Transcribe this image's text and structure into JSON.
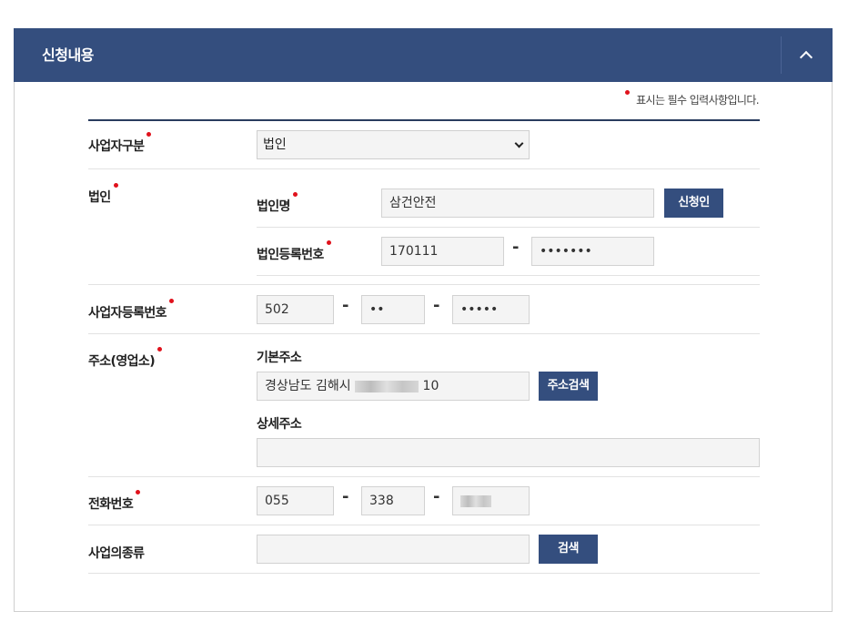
{
  "panel": {
    "title": "신청내용",
    "required_note": "표시는 필수 입력사항입니다."
  },
  "form": {
    "business_type": {
      "label": "사업자구분",
      "selected": "법인"
    },
    "corporation": {
      "label": "법인",
      "name": {
        "label": "법인명",
        "value": "삼건안전",
        "button": "신청인"
      },
      "reg_no": {
        "label": "법인등록번호",
        "part1": "170111",
        "part2": "•••••••"
      }
    },
    "business_reg_no": {
      "label": "사업자등록번호",
      "part1": "502",
      "part2": "••",
      "part3": "•••••"
    },
    "address": {
      "label": "주소(영업소)",
      "basic_label": "기본주소",
      "basic_prefix": "경상남도 김해시",
      "basic_suffix": "10",
      "search_button": "주소검색",
      "detail_label": "상세주소",
      "detail_value": ""
    },
    "phone": {
      "label": "전화번호",
      "part1": "055",
      "part2": "338",
      "part3": ""
    },
    "business_category": {
      "label": "사업의종류",
      "value": "",
      "search_button": "검색"
    }
  }
}
